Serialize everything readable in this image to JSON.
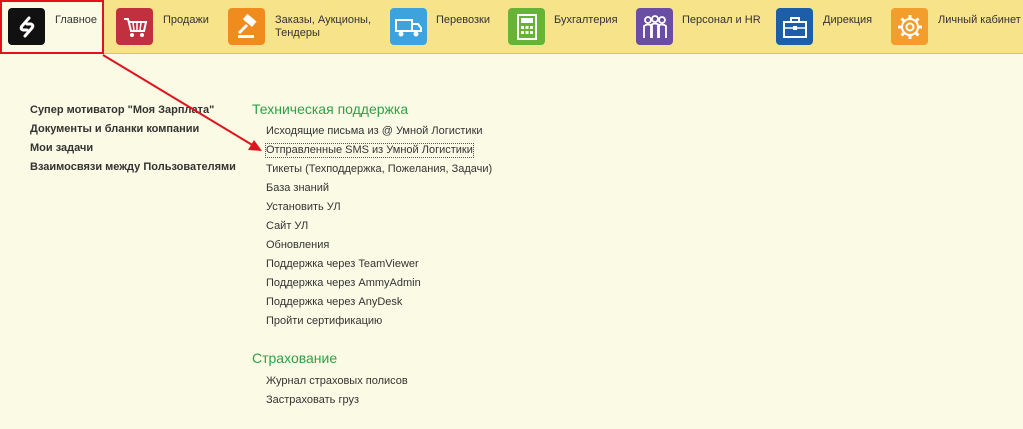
{
  "sections": [
    {
      "name": "section-main",
      "label": "Главное",
      "icon": "logo-icon",
      "color": "#111111"
    },
    {
      "name": "section-sales",
      "label": "Продажи",
      "icon": "cart-icon",
      "color": "#c1303f"
    },
    {
      "name": "section-orders",
      "label": "Заказы,  Аукционы, Тендеры",
      "icon": "gavel-icon",
      "color": "#f08c1d"
    },
    {
      "name": "section-transport",
      "label": "Перевозки",
      "icon": "truck-icon",
      "color": "#3da3df"
    },
    {
      "name": "section-accounting",
      "label": "Бухгалтерия",
      "icon": "calculator-icon",
      "color": "#66b335"
    },
    {
      "name": "section-hr",
      "label": "Персонал и HR",
      "icon": "people-icon",
      "color": "#6a4ea3"
    },
    {
      "name": "section-direction",
      "label": "Дирекция",
      "icon": "briefcase-icon",
      "color": "#1c5fa8"
    },
    {
      "name": "section-cabinet",
      "label": "Личный кабинет",
      "icon": "gear-icon",
      "color": "#f29d2c"
    }
  ],
  "favorites": [
    "Супер мотиватор \"Моя Зарплата\"",
    "Документы и бланки компании",
    "Мои задачи",
    "Взаимосвязи между Пользователями"
  ],
  "support": {
    "title": "Техническая поддержка",
    "items": [
      "Исходящие письма из @ Умной Логистики",
      "Отправленные SMS из Умной Логистики",
      "Тикеты (Техподдержка, Пожелания, Задачи)",
      "База знаний",
      "Установить УЛ",
      "Сайт УЛ",
      "Обновления",
      "Поддержка через TeamViewer",
      "Поддержка через AmmyAdmin",
      "Поддержка через AnyDesk",
      "Пройти сертификацию"
    ]
  },
  "insurance": {
    "title": "Страхование",
    "items": [
      "Журнал страховых полисов",
      "Застраховать груз"
    ]
  },
  "colors": {
    "accent_green": "#2ea046",
    "highlight_red": "#e0121d",
    "topbar_bg": "#f7e389"
  }
}
